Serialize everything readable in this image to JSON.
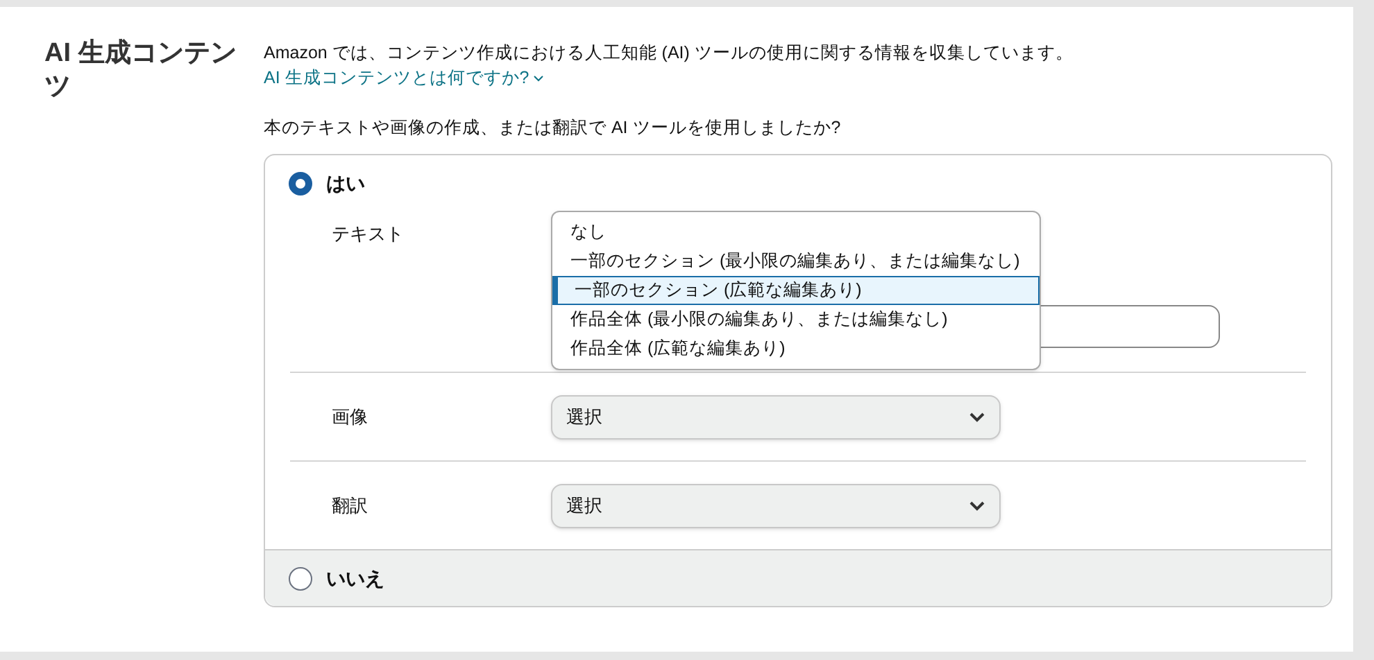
{
  "section_title": "AI 生成コンテンツ",
  "intro": "Amazon では、コンテンツ作成における人工知能 (AI) ツールの使用に関する情報を収集しています。",
  "help_link": "AI 生成コンテンツとは何ですか?",
  "question": "本のテキストや画像の作成、または翻訳で AI ツールを使用しましたか?",
  "options": [
    {
      "label": "はい",
      "selected": true,
      "fields": [
        {
          "label": "テキスト",
          "expanded": true,
          "menu": [
            {
              "label": "なし",
              "selected": false
            },
            {
              "label": "一部のセクション (最小限の編集あり、または編集なし)",
              "selected": false
            },
            {
              "label": "一部のセクション (広範な編集あり)",
              "selected": true
            },
            {
              "label": "作品全体 (最小限の編集あり、または編集なし)",
              "selected": false
            },
            {
              "label": "作品全体 (広範な編集あり)",
              "selected": false
            }
          ]
        },
        {
          "label": "画像",
          "expanded": false,
          "value": "選択"
        },
        {
          "label": "翻訳",
          "expanded": false,
          "value": "選択"
        }
      ]
    },
    {
      "label": "いいえ",
      "selected": false
    }
  ]
}
